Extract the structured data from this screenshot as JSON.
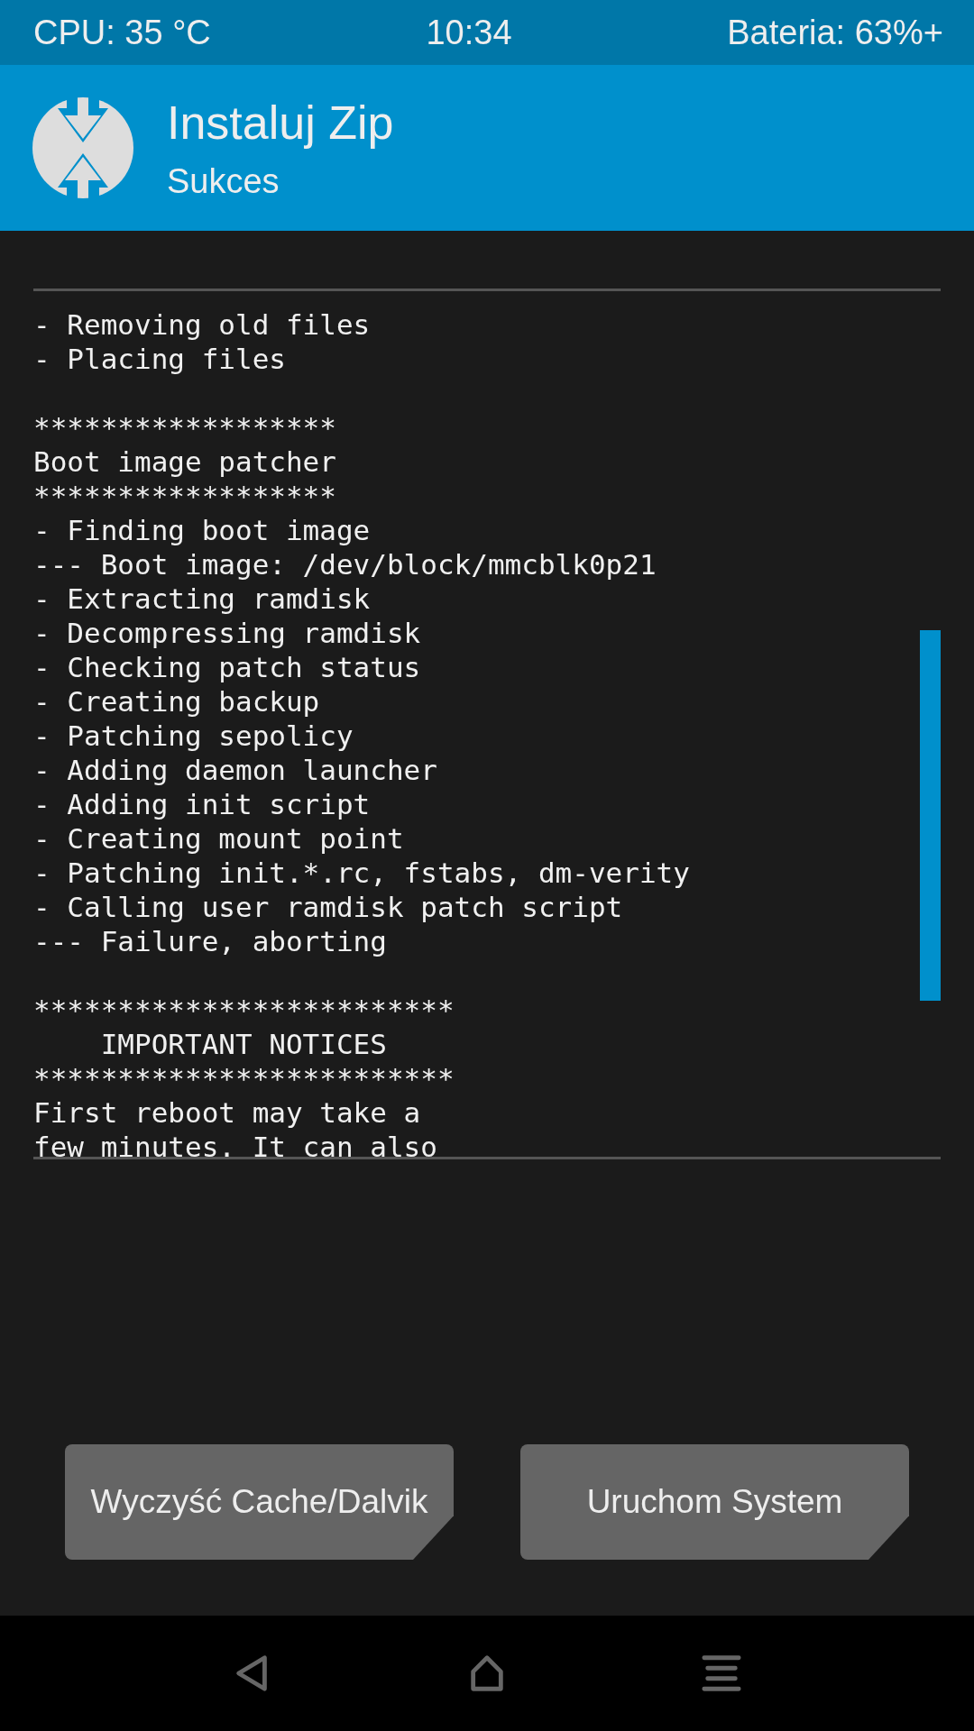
{
  "status_bar": {
    "cpu": "CPU: 35 °C",
    "time": "10:34",
    "battery": "Bateria: 63%+"
  },
  "header": {
    "title": "Instaluj Zip",
    "subtitle": "Sukces"
  },
  "log": {
    "blocks": [
      [
        "- Removing old files",
        "- Placing files"
      ],
      [
        "******************",
        "Boot image patcher",
        "******************",
        "- Finding boot image",
        "--- Boot image: /dev/block/mmcblk0p21",
        "- Extracting ramdisk",
        "- Decompressing ramdisk",
        "- Checking patch status",
        "- Creating backup",
        "- Patching sepolicy",
        "- Adding daemon launcher",
        "- Adding init script",
        "- Creating mount point",
        "- Patching init.*.rc, fstabs, dm-verity",
        "- Calling user ramdisk patch script",
        "--- Failure, aborting"
      ],
      [
        "*************************",
        "    IMPORTANT NOTICES",
        "*************************",
        "First reboot may take a",
        "few minutes. It can also"
      ]
    ]
  },
  "buttons": [
    "Wyczyść Cache/Dalvik",
    "Uruchom System"
  ]
}
